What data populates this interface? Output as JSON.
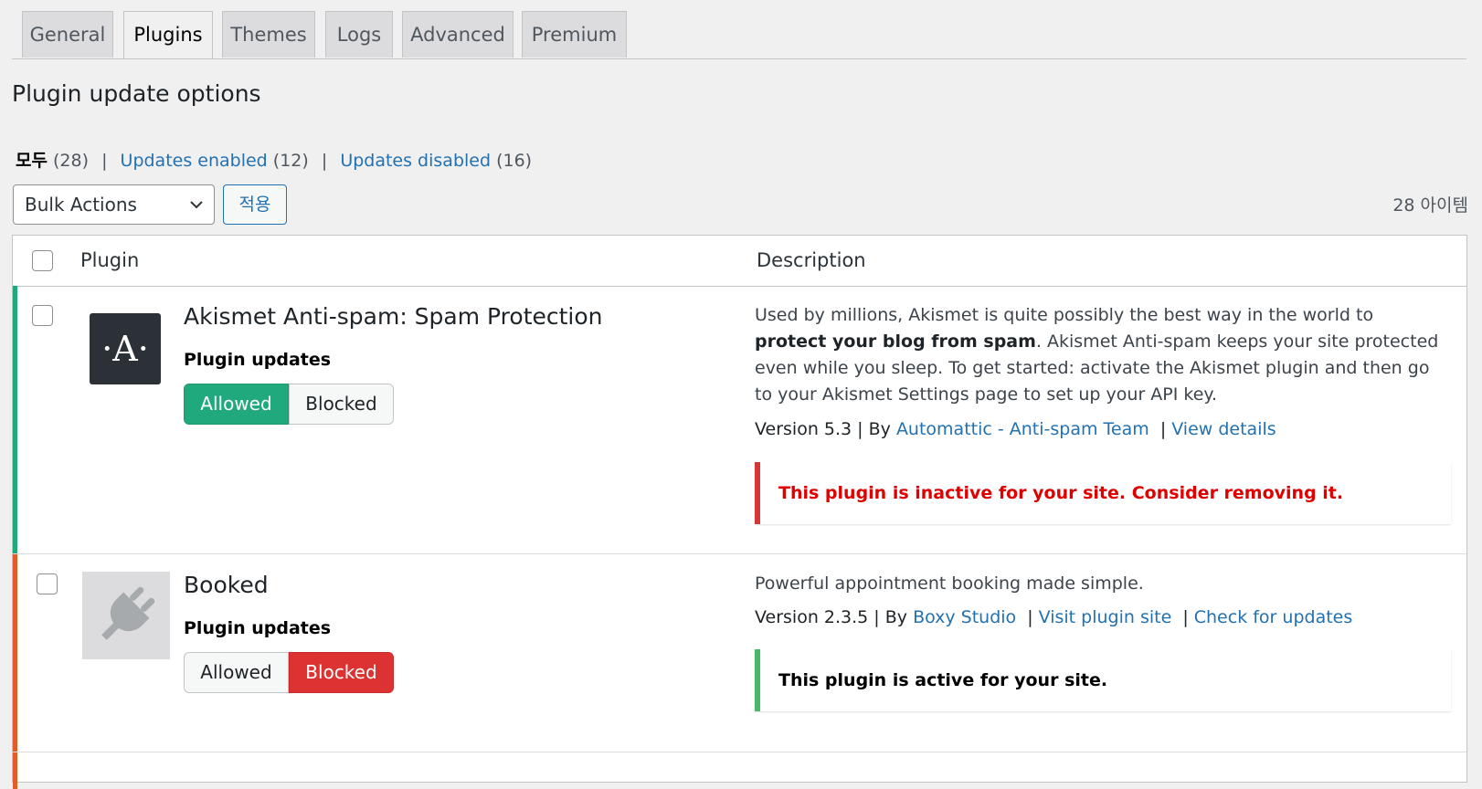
{
  "tabs": [
    {
      "label": "General"
    },
    {
      "label": "Plugins"
    },
    {
      "label": "Themes"
    },
    {
      "label": "Logs"
    },
    {
      "label": "Advanced"
    },
    {
      "label": "Premium"
    }
  ],
  "active_tab": "Plugins",
  "page_title": "Plugin update options",
  "filters": {
    "all_label": "모두",
    "all_count": "(28)",
    "enabled_label": "Updates enabled",
    "enabled_count": "(12)",
    "disabled_label": "Updates disabled",
    "disabled_count": "(16)",
    "separator": "|"
  },
  "bulk": {
    "select_value": "Bulk Actions",
    "apply_label": "적용"
  },
  "items_count": "28 아이템",
  "table": {
    "col_plugin": "Plugin",
    "col_description": "Description"
  },
  "plugins": [
    {
      "name": "Akismet Anti-spam: Spam Protection",
      "icon_letter": "·A·",
      "updates_label": "Plugin updates",
      "allowed_label": "Allowed",
      "blocked_label": "Blocked",
      "state": "allowed",
      "desc_part1": "Used by millions, Akismet is quite possibly the best way in the world to ",
      "desc_bold": "protect your blog from spam",
      "desc_part2": ". Akismet Anti-spam keeps your site protected even while you sleep. To get started: activate the Akismet plugin and then go to your Akismet Settings page to set up your API key.",
      "version_text": "Version 5.3 | By",
      "author": "Automattic - Anti-spam Team",
      "link1": "View details",
      "notice": "This plugin is inactive for your site. Consider removing it.",
      "notice_color": "#d63638",
      "strip_color": "#1fa97c"
    },
    {
      "name": "Booked",
      "icon": "plug-icon",
      "updates_label": "Plugin updates",
      "allowed_label": "Allowed",
      "blocked_label": "Blocked",
      "state": "blocked",
      "description": "Powerful appointment booking made simple.",
      "version_text": "Version 2.3.5 | By",
      "author": "Boxy Studio",
      "link1": "Visit plugin site",
      "link2": "Check for updates",
      "notice": "This plugin is active for your site.",
      "notice_color": "#00a32a",
      "strip_color": "#e05d2a"
    }
  ]
}
